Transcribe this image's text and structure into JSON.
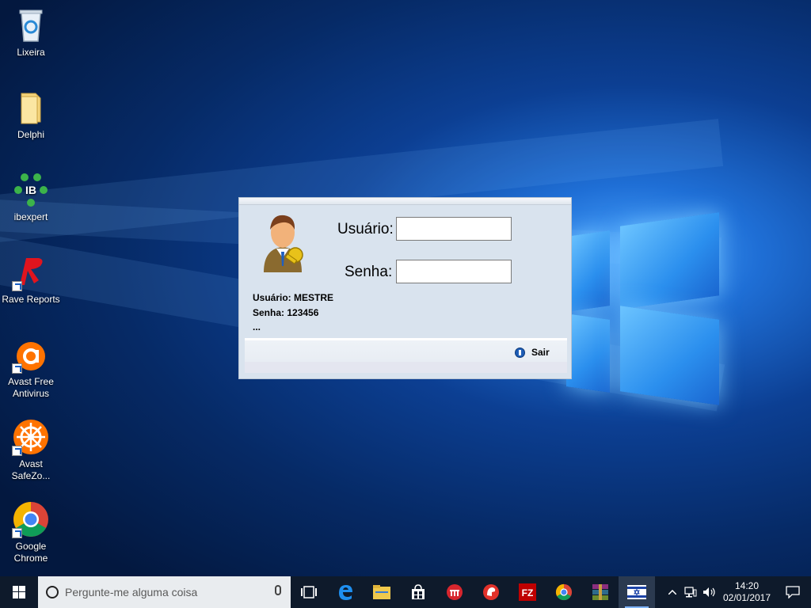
{
  "desktop": {
    "icons": [
      {
        "label": "Lixeira",
        "icon": "recycle-bin-icon"
      },
      {
        "label": "Delphi",
        "icon": "folder-icon"
      },
      {
        "label": "ibexpert",
        "icon": "ibexpert-icon"
      },
      {
        "label": "Rave Reports",
        "icon": "rave-reports-icon"
      },
      {
        "label": "Avast Free Antivirus",
        "icon": "avast-icon"
      },
      {
        "label": "Avast SafeZo...",
        "icon": "avast-safezone-icon"
      },
      {
        "label": "Google Chrome",
        "icon": "chrome-icon"
      }
    ],
    "ibexpert_glyph": "IB"
  },
  "login": {
    "user_label": "Usuário:",
    "password_label": "Senha:",
    "user_value": "",
    "password_value": "",
    "hint_user": "Usuário: MESTRE",
    "hint_password": "Senha: 123456",
    "hint_more": "...",
    "exit_label": "Sair"
  },
  "taskbar": {
    "search_placeholder": "Pergunte-me alguma coisa",
    "apps": [
      "task-view-icon",
      "edge-icon",
      "file-explorer-icon",
      "store-icon",
      "app-red-icon",
      "app-spartan-icon",
      "filezilla-icon",
      "chrome-icon",
      "winrar-icon",
      "flag-app-icon"
    ],
    "filezilla_glyph": "FZ",
    "time": "14:20",
    "date": "02/01/2017"
  },
  "colors": {
    "accent": "#1f6fd6",
    "taskbar": "#0e1a2b",
    "dialog": "#d9e3ee"
  }
}
